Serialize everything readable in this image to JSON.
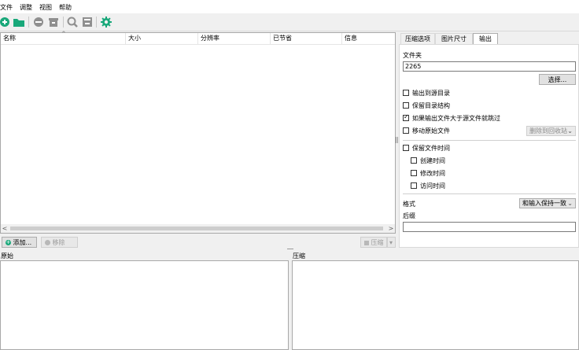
{
  "menu": [
    "文件",
    "调整",
    "视图",
    "帮助"
  ],
  "toolbar": {
    "icons": [
      "add-icon",
      "folder-icon",
      "remove-icon",
      "archive-icon",
      "search-icon",
      "archive-out-icon",
      "gear-icon"
    ],
    "colors": {
      "green": "#19a87a",
      "gray": "#8f8f8f"
    }
  },
  "file_list": {
    "columns": [
      "名称",
      "大小",
      "分辨率",
      "已节省",
      "信息"
    ],
    "rows": []
  },
  "buttons": {
    "add": "添加...",
    "remove": "移除",
    "compress": "压缩"
  },
  "tabs": [
    "压缩选项",
    "图片尺寸",
    "输出"
  ],
  "active_tab": "输出",
  "output": {
    "folder_label": "文件夹",
    "folder_value": "2265",
    "choose_button": "选择...",
    "options": [
      {
        "label": "输出到源目录",
        "checked": false
      },
      {
        "label": "保留目录结构",
        "checked": false
      },
      {
        "label": "如果输出文件大于源文件就跳过",
        "checked": true
      },
      {
        "label": "移动原始文件",
        "checked": false
      }
    ],
    "move_target": "删除到回收站",
    "keep_time": {
      "label": "保留文件时间",
      "checked": false
    },
    "time_options": [
      {
        "label": "创建时间",
        "checked": false
      },
      {
        "label": "修改时间",
        "checked": false
      },
      {
        "label": "访问时间",
        "checked": false
      }
    ],
    "format_label": "格式",
    "format_value": "和输入保持一致",
    "suffix_label": "后缀",
    "suffix_value": ""
  },
  "bottom": {
    "original_label": "原始",
    "compressed_label": "压缩"
  }
}
